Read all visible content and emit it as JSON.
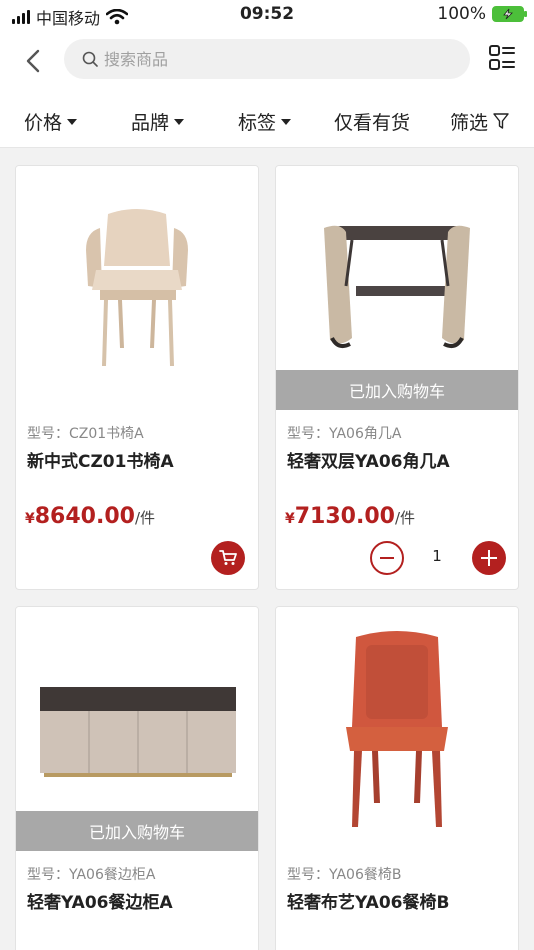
{
  "status_bar": {
    "carrier": "中国移动",
    "time": "09:52",
    "battery": "100%"
  },
  "search": {
    "placeholder": "搜索商品"
  },
  "filters": [
    {
      "label": "价格",
      "has_dropdown": true
    },
    {
      "label": "品牌",
      "has_dropdown": true
    },
    {
      "label": "标签",
      "has_dropdown": true
    },
    {
      "label": "仅看有货",
      "has_dropdown": false
    },
    {
      "label": "筛选",
      "has_dropdown": false
    }
  ],
  "products": [
    {
      "model_label": "型号：CZ01书椅A",
      "name": "新中式CZ01书椅A",
      "price_symbol": "¥",
      "price": "8640.00",
      "unit": "/件",
      "added_to_cart": false,
      "image_icon": "beige-armchair-icon"
    },
    {
      "model_label": "型号：YA06角几A",
      "name": "轻奢双层YA06角几A",
      "price_symbol": "¥",
      "price": "7130.00",
      "unit": "/件",
      "added_to_cart": true,
      "added_label": "已加入购物车",
      "quantity": "1",
      "image_icon": "side-table-icon"
    },
    {
      "model_label": "型号：YA06餐边柜A",
      "name": "轻奢YA06餐边柜A",
      "price_symbol": "",
      "price": "",
      "unit": "",
      "added_to_cart": true,
      "added_label": "已加入购物车",
      "image_icon": "sideboard-icon"
    },
    {
      "model_label": "型号：YA06餐椅B",
      "name": "轻奢布艺YA06餐椅B",
      "price_symbol": "",
      "price": "",
      "unit": "",
      "added_to_cart": false,
      "image_icon": "orange-dining-chair-icon"
    }
  ],
  "colors": {
    "accent": "#b3201f",
    "banner": "#a8a8a8",
    "battery": "#4cbf3a"
  }
}
